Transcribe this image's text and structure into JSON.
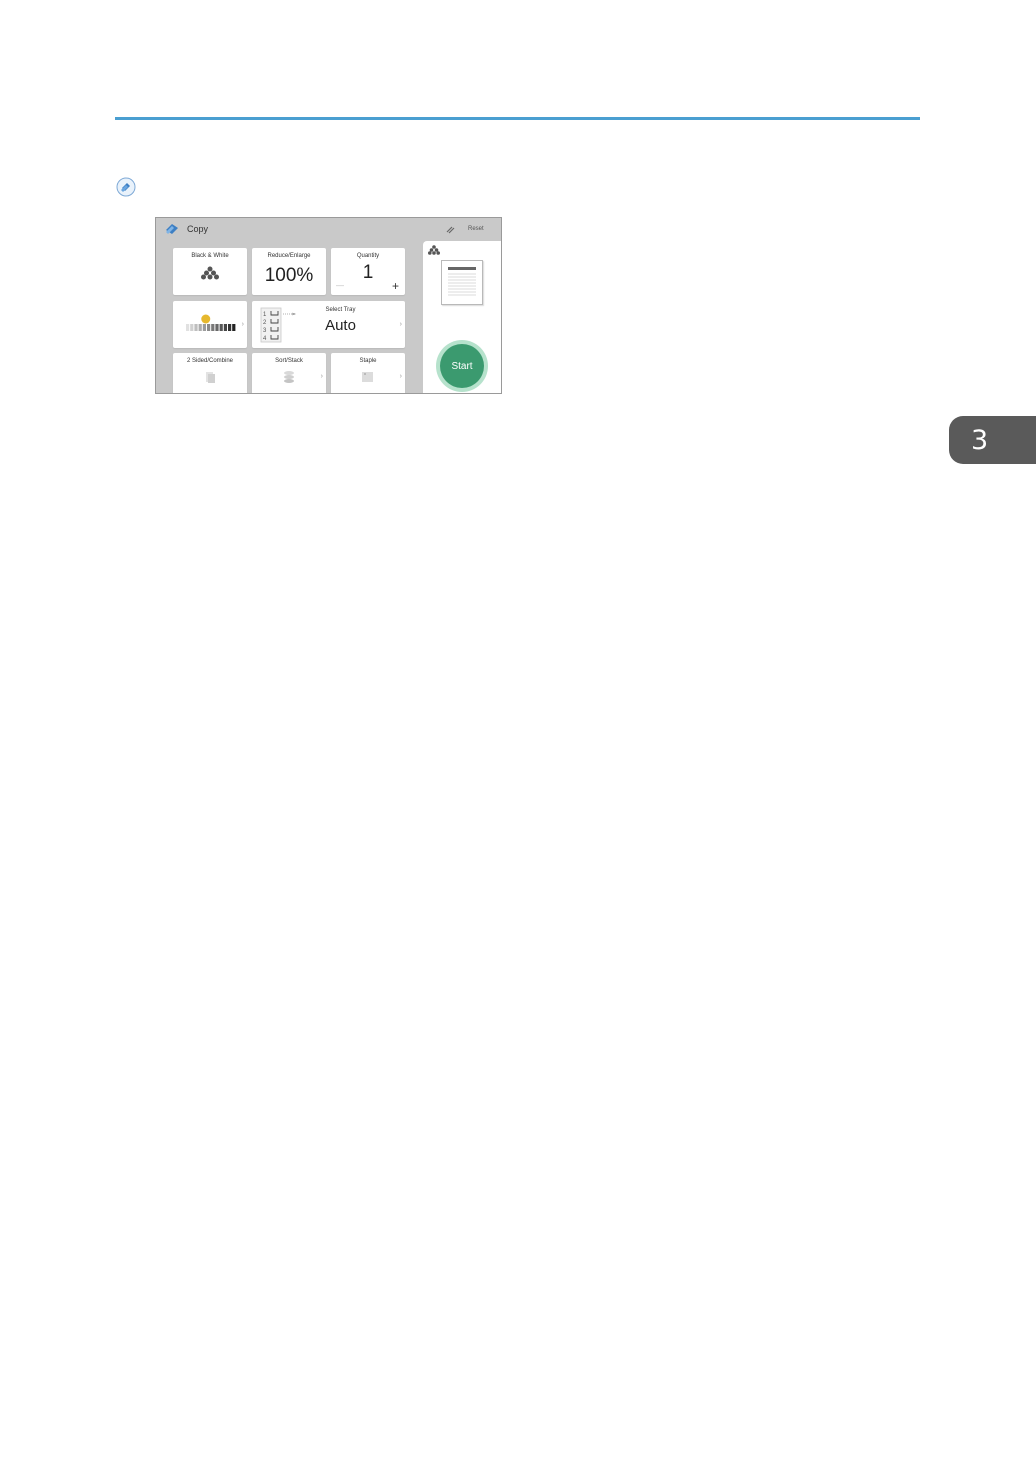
{
  "chapter_tab": {
    "number": "3"
  },
  "panel": {
    "header": {
      "title": "Copy",
      "reset_label": "Reset"
    },
    "tiles": {
      "color_mode": {
        "label": "Black & White"
      },
      "reduce_enlarge": {
        "label": "Reduce/Enlarge",
        "value": "100%"
      },
      "quantity": {
        "label": "Quantity",
        "value": "1",
        "minus": "—",
        "plus": "+"
      },
      "density": {
        "level_fraction": 0.4
      },
      "select_tray": {
        "label": "Select Tray",
        "value": "Auto",
        "tray_numbers": [
          "1",
          "2",
          "3",
          "4"
        ]
      },
      "two_sided": {
        "label": "2 Sided/Combine"
      },
      "sort_stack": {
        "label": "Sort/Stack"
      },
      "staple": {
        "label": "Staple"
      }
    },
    "start_button": {
      "label": "Start"
    }
  },
  "colors": {
    "rule": "#4a9fd1",
    "start": "#3b9a6f",
    "density_marker": "#e6b82e",
    "chapter_tab": "#5a5a5a"
  }
}
